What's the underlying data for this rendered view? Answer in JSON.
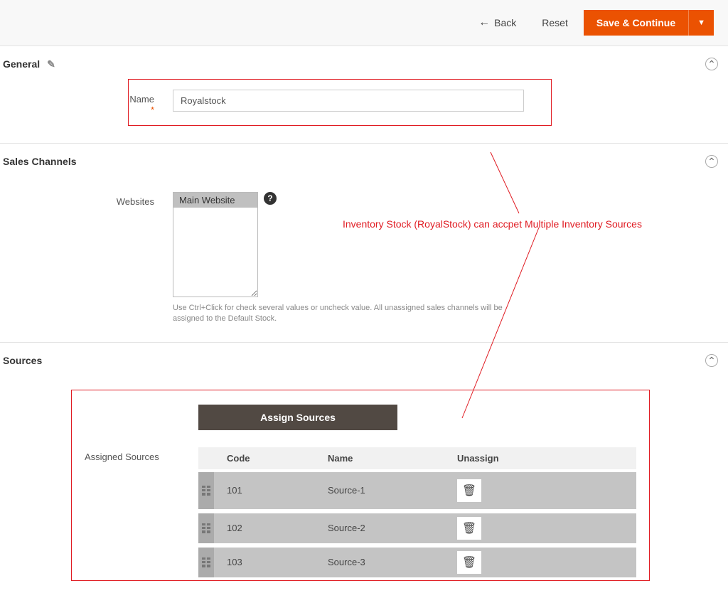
{
  "toolbar": {
    "back_label": "Back",
    "reset_label": "Reset",
    "save_label": "Save & Continue"
  },
  "sections": {
    "general": {
      "title": "General",
      "name_label": "Name",
      "name_value": "Royalstock"
    },
    "sales_channels": {
      "title": "Sales Channels",
      "websites_label": "Websites",
      "selected_option": "Main Website",
      "hint": "Use Ctrl+Click for check several values or uncheck value. All unassigned sales channels will be assigned to the Default Stock."
    },
    "sources": {
      "title": "Sources",
      "assign_button": "Assign Sources",
      "assigned_label": "Assigned Sources",
      "columns": {
        "code": "Code",
        "name": "Name",
        "unassign": "Unassign"
      },
      "rows": [
        {
          "code": "101",
          "name": "Source-1"
        },
        {
          "code": "102",
          "name": "Source-2"
        },
        {
          "code": "103",
          "name": "Source-3"
        }
      ]
    }
  },
  "annotation_text": "Inventory Stock (RoyalStock) can accpet Multiple Inventory Sources"
}
